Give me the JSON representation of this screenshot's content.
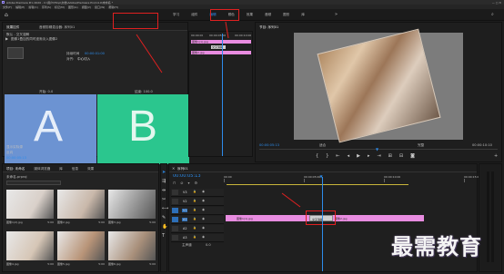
{
  "title_bar": {
    "title": "Adobe Premiere Pro 2020 - C:\\用户\\Htop\\文档\\Adobe\\Premiere Pro\\14.0\\未命名 *"
  },
  "menu": [
    "文件(F)",
    "编辑(E)",
    "剪辑(C)",
    "序列(S)",
    "标记(M)",
    "图形(G)",
    "视图(V)",
    "窗口(W)",
    "帮助(H)"
  ],
  "workspaces": [
    "学习",
    "组件",
    "编辑",
    "颜色",
    "效果",
    "音频",
    "图形",
    "库"
  ],
  "active_workspace": "编辑",
  "effect_controls": {
    "tabs": [
      "效果控件",
      "音频剪辑混合器: 序列01"
    ],
    "clip_label": "默认 - 交叉溶解",
    "description": "图像1叠加的同时逐渐淡入图像2",
    "duration_label": "持续时间",
    "duration": "00:00:01:00",
    "align_label": "对齐:",
    "align_value": "中心切入",
    "start_label": "开始: 0.0",
    "end_label": "结束: 100.0",
    "show_actual_sources": "显示实际源",
    "reverse": "反向",
    "tile_a": "A",
    "tile_b": "B",
    "timecode": "00:00:05:13"
  },
  "mini_timeline": {
    "times": [
      "00:00:00",
      "00:00:05:00",
      "00:00:10:00"
    ],
    "clip1": "图像1(1).jpg",
    "clip2": "图像2.jpg",
    "transition": "交叉溶解"
  },
  "program": {
    "tab": "节目: 序列01",
    "timecode_left": "00:00:05:13",
    "fit": "适合",
    "quality": "完整",
    "timecode_right": "00:00:10:10"
  },
  "project": {
    "tabs": [
      "项目: 未命名",
      "媒体浏览器",
      "库",
      "信息",
      "效果"
    ],
    "file": "未命名.prproj",
    "items": [
      {
        "name": "图像1(2).jpg",
        "dur": "5:00"
      },
      {
        "name": "图像2.jpg",
        "dur": "5:00"
      },
      {
        "name": "图像3.jpg",
        "dur": "5:00"
      },
      {
        "name": "图像4.jpg",
        "dur": "5:00"
      },
      {
        "name": "图像5.jpg",
        "dur": "5:00"
      },
      {
        "name": "图像6.jpg",
        "dur": "5:00"
      }
    ]
  },
  "timeline": {
    "tab": "序列01",
    "timecode": "00:00:05:13",
    "ruler": [
      "00:00",
      "00:00:05:00",
      "00:00:10:00",
      "00:00:15:00"
    ],
    "tracks": [
      "V3",
      "V2",
      "V1",
      "A1",
      "A2",
      "A3"
    ],
    "master": "主声道",
    "master_value": "0.0",
    "clip1": "图像1(1).jpg",
    "clip2": "图像2.jpg",
    "transition": "交叉溶解"
  },
  "watermark": "最需教育",
  "colors": {
    "accent": "#2d8ceb",
    "clip": "#e88ce0",
    "annotation": "#e02020"
  }
}
